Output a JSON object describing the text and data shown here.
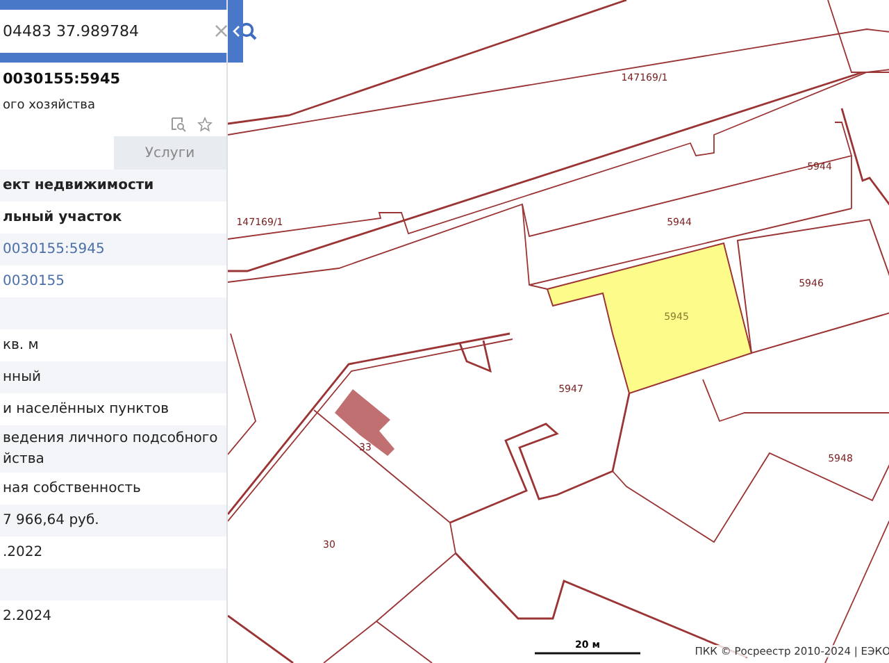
{
  "search": {
    "value": "04483 37.989784",
    "clear": "×"
  },
  "object": {
    "title": "0030155:5945",
    "subtitle": "ого хозяйства"
  },
  "tabs": [
    {
      "selected": true
    },
    {
      "label": "Услуги",
      "selected": false
    }
  ],
  "rows": [
    {
      "kind": "bold",
      "text": "ект недвижимости"
    },
    {
      "kind": "bold",
      "text": "льный участок"
    },
    {
      "kind": "link",
      "text": "0030155:5945"
    },
    {
      "kind": "link",
      "text": "0030155"
    },
    {
      "kind": "empty"
    },
    {
      "kind": "text",
      "text": "кв. м"
    },
    {
      "kind": "text",
      "text": "нный"
    },
    {
      "kind": "text",
      "text": "и населённых пунктов"
    },
    {
      "kind": "text",
      "text": "ведения личного подсобного йства"
    },
    {
      "kind": "text",
      "text": "ная собственность"
    },
    {
      "kind": "text",
      "text": "7 966,64 руб."
    },
    {
      "kind": "text",
      "text": ".2022"
    },
    {
      "kind": "empty"
    },
    {
      "kind": "text",
      "text": "2.2024"
    }
  ],
  "map": {
    "parcels": [
      {
        "label": "147169/1",
        "selected": false
      },
      {
        "label": "147169/1",
        "selected": false
      },
      {
        "label": "5944",
        "selected": false
      },
      {
        "label": "5944",
        "selected": false
      },
      {
        "label": "5946",
        "selected": false
      },
      {
        "label": "5945",
        "selected": true
      },
      {
        "label": "5947",
        "selected": false
      },
      {
        "label": "5948",
        "selected": false
      },
      {
        "label": "30",
        "selected": false
      },
      {
        "label": "33",
        "selected": false
      }
    ],
    "scale": "20 м",
    "attribution": "ПКК © Росреестр 2010-2024 | ЕЭКО"
  }
}
